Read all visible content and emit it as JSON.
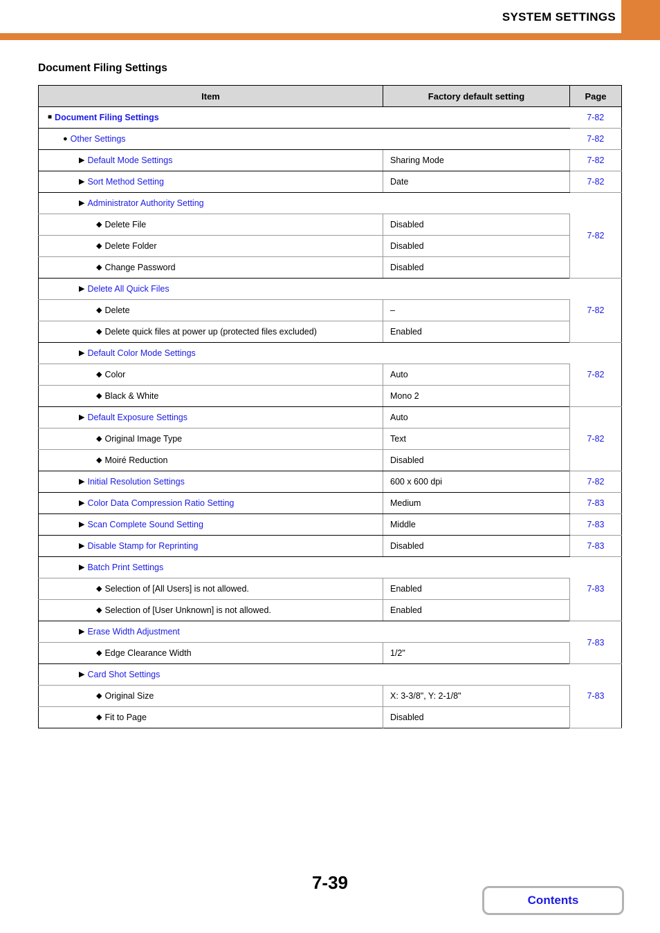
{
  "header": {
    "title": "SYSTEM SETTINGS",
    "accent_color": "#e08137"
  },
  "section": {
    "title": "Document Filing Settings"
  },
  "table": {
    "columns": {
      "item": "Item",
      "value": "Factory default setting",
      "page": "Page"
    },
    "link_color": "#1a1ae6",
    "rows": [
      {
        "level": 0,
        "marker": "square",
        "label": "Document Filing Settings",
        "link": true,
        "bold": true,
        "value": null,
        "page": "7-82"
      },
      {
        "level": 1,
        "marker": "circle",
        "label": "Other Settings",
        "link": true,
        "bold": false,
        "value": null,
        "page": "7-82"
      },
      {
        "level": 2,
        "marker": "triangle",
        "label": "Default Mode Settings",
        "link": true,
        "bold": false,
        "value": "Sharing Mode",
        "page": "7-82"
      },
      {
        "level": 2,
        "marker": "triangle",
        "label": "Sort Method Setting",
        "link": true,
        "bold": false,
        "value": "Date",
        "page": "7-82"
      },
      {
        "level": 2,
        "marker": "triangle",
        "label": "Administrator Authority Setting",
        "link": true,
        "bold": false,
        "value": null,
        "page": "7-82"
      },
      {
        "level": 3,
        "marker": "diamond",
        "label": "Delete File",
        "link": false,
        "bold": false,
        "value": "Disabled",
        "page": null
      },
      {
        "level": 3,
        "marker": "diamond",
        "label": "Delete Folder",
        "link": false,
        "bold": false,
        "value": "Disabled",
        "page": null
      },
      {
        "level": 3,
        "marker": "diamond",
        "label": "Change Password",
        "link": false,
        "bold": false,
        "value": "Disabled",
        "page": null
      },
      {
        "level": 2,
        "marker": "triangle",
        "label": "Delete All Quick Files",
        "link": true,
        "bold": false,
        "value": null,
        "page": "7-82"
      },
      {
        "level": 3,
        "marker": "diamond",
        "label": "Delete",
        "link": false,
        "bold": false,
        "value": "–",
        "page": null
      },
      {
        "level": 3,
        "marker": "diamond",
        "label": "Delete quick files at power up (protected files excluded)",
        "link": false,
        "bold": false,
        "value": "Enabled",
        "page": null
      },
      {
        "level": 2,
        "marker": "triangle",
        "label": "Default Color Mode Settings",
        "link": true,
        "bold": false,
        "value": null,
        "page": "7-82"
      },
      {
        "level": 3,
        "marker": "diamond",
        "label": "Color",
        "link": false,
        "bold": false,
        "value": "Auto",
        "page": null
      },
      {
        "level": 3,
        "marker": "diamond",
        "label": "Black & White",
        "link": false,
        "bold": false,
        "value": "Mono 2",
        "page": null
      },
      {
        "level": 2,
        "marker": "triangle",
        "label": "Default Exposure Settings",
        "link": true,
        "bold": false,
        "value": "Auto",
        "page": "7-82"
      },
      {
        "level": 3,
        "marker": "diamond",
        "label": "Original Image Type",
        "link": false,
        "bold": false,
        "value": "Text",
        "page": null
      },
      {
        "level": 3,
        "marker": "diamond",
        "label": "Moiré Reduction",
        "link": false,
        "bold": false,
        "value": "Disabled",
        "page": null
      },
      {
        "level": 2,
        "marker": "triangle",
        "label": "Initial Resolution Settings",
        "link": true,
        "bold": false,
        "value": "600 x 600 dpi",
        "page": "7-82"
      },
      {
        "level": 2,
        "marker": "triangle",
        "label": "Color Data Compression Ratio Setting",
        "link": true,
        "bold": false,
        "value": "Medium",
        "page": "7-83"
      },
      {
        "level": 2,
        "marker": "triangle",
        "label": "Scan Complete Sound Setting",
        "link": true,
        "bold": false,
        "value": "Middle",
        "page": "7-83"
      },
      {
        "level": 2,
        "marker": "triangle",
        "label": "Disable Stamp for Reprinting",
        "link": true,
        "bold": false,
        "value": "Disabled",
        "page": "7-83"
      },
      {
        "level": 2,
        "marker": "triangle",
        "label": "Batch Print Settings",
        "link": true,
        "bold": false,
        "value": null,
        "page": "7-83"
      },
      {
        "level": 3,
        "marker": "diamond",
        "label": "Selection of [All Users] is not allowed.",
        "link": false,
        "bold": false,
        "value": "Enabled",
        "page": null
      },
      {
        "level": 3,
        "marker": "diamond",
        "label": "Selection of [User Unknown] is not allowed.",
        "link": false,
        "bold": false,
        "value": "Enabled",
        "page": null
      },
      {
        "level": 2,
        "marker": "triangle",
        "label": "Erase Width Adjustment",
        "link": true,
        "bold": false,
        "value": null,
        "page": "7-83"
      },
      {
        "level": 3,
        "marker": "diamond",
        "label": "Edge Clearance Width",
        "link": false,
        "bold": false,
        "value": "1/2\"",
        "page": null
      },
      {
        "level": 2,
        "marker": "triangle",
        "label": "Card Shot Settings",
        "link": true,
        "bold": false,
        "value": null,
        "page": "7-83"
      },
      {
        "level": 3,
        "marker": "diamond",
        "label": "Original Size",
        "link": false,
        "bold": false,
        "value": "X: 3-3/8\", Y: 2-1/8\"",
        "page": null
      },
      {
        "level": 3,
        "marker": "diamond",
        "label": "Fit to Page",
        "link": false,
        "bold": false,
        "value": "Disabled",
        "page": null
      }
    ],
    "page_groups": [
      {
        "page": "7-82",
        "start": 0,
        "span": 1
      },
      {
        "page": "7-82",
        "start": 1,
        "span": 1
      },
      {
        "page": "7-82",
        "start": 2,
        "span": 1
      },
      {
        "page": "7-82",
        "start": 3,
        "span": 1
      },
      {
        "page": "7-82",
        "start": 4,
        "span": 4
      },
      {
        "page": "7-82",
        "start": 8,
        "span": 3
      },
      {
        "page": "7-82",
        "start": 11,
        "span": 3
      },
      {
        "page": "7-82",
        "start": 14,
        "span": 3
      },
      {
        "page": "7-82",
        "start": 17,
        "span": 1
      },
      {
        "page": "7-83",
        "start": 18,
        "span": 1
      },
      {
        "page": "7-83",
        "start": 19,
        "span": 1
      },
      {
        "page": "7-83",
        "start": 20,
        "span": 1
      },
      {
        "page": "7-83",
        "start": 21,
        "span": 3
      },
      {
        "page": "7-83",
        "start": 24,
        "span": 2
      },
      {
        "page": "7-83",
        "start": 26,
        "span": 3
      }
    ]
  },
  "footer": {
    "folio": "7-39",
    "contents_label": "Contents"
  }
}
